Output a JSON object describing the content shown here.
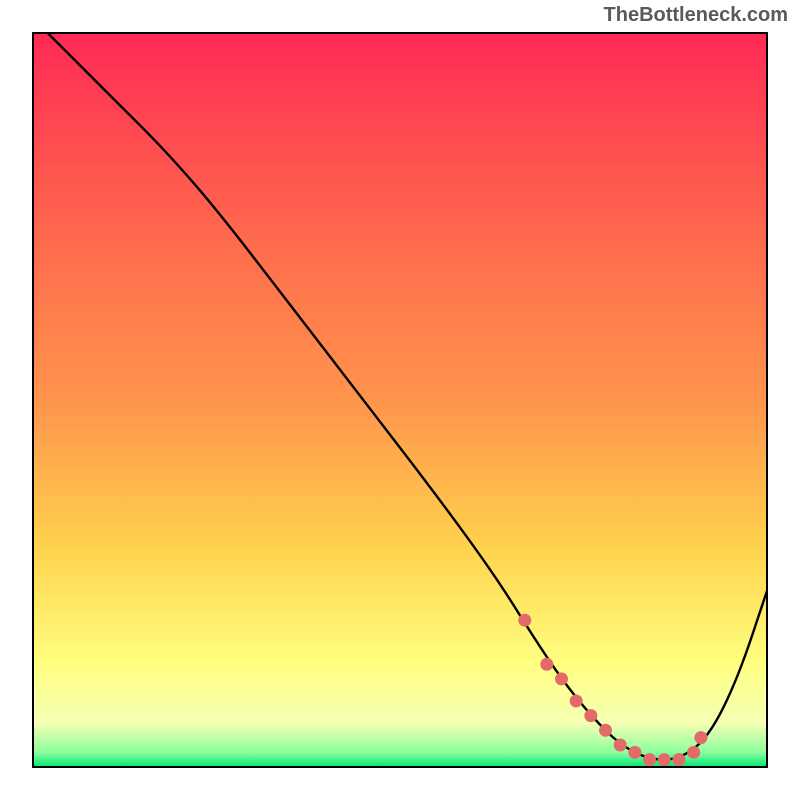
{
  "watermark": "TheBottleneck.com",
  "colors": {
    "gradient_top": "#ff2a55",
    "gradient_mid_orange": "#ff944d",
    "gradient_mid_yellow": "#ffd24d",
    "gradient_light_yellow": "#ffff80",
    "gradient_pale": "#f5ffb3",
    "gradient_green": "#00e673",
    "line": "#000000",
    "marker": "#e46a6a",
    "border": "#000000"
  },
  "chart_data": {
    "type": "line",
    "title": "",
    "xlabel": "",
    "ylabel": "",
    "xlim": [
      0,
      100
    ],
    "ylim": [
      0,
      100
    ],
    "series": [
      {
        "name": "curve",
        "x": [
          2,
          8,
          12,
          18,
          25,
          35,
          45,
          55,
          63,
          68,
          72,
          76,
          80,
          84,
          88,
          92,
          96,
          100
        ],
        "values": [
          100,
          94,
          90,
          84,
          76,
          63,
          50,
          37,
          26,
          18,
          12,
          7,
          3,
          1,
          1,
          4,
          12,
          24
        ]
      }
    ],
    "highlight_markers": {
      "name": "highlight",
      "x": [
        67,
        70,
        72,
        74,
        76,
        78,
        80,
        82,
        84,
        86,
        88,
        90,
        91
      ],
      "values": [
        20,
        14,
        12,
        9,
        7,
        5,
        3,
        2,
        1,
        1,
        1,
        2,
        4
      ]
    }
  }
}
